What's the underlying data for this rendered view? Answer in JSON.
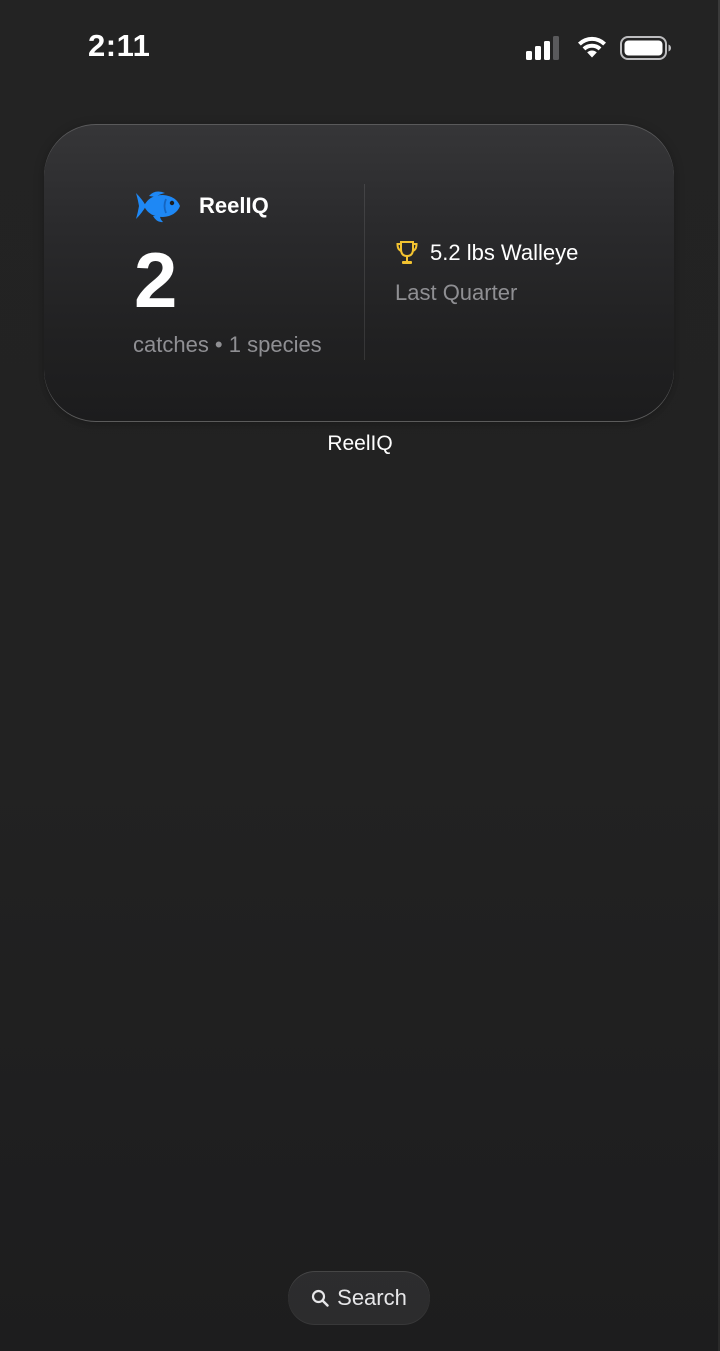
{
  "status_bar": {
    "time": "2:11",
    "icons": [
      "signal-icon",
      "wifi-icon",
      "battery-icon"
    ]
  },
  "widget": {
    "app_name": "ReelIQ",
    "app_icon": "fish-icon",
    "icon_color": "#1e88f5",
    "catch_count": "2",
    "subtitle": "catches • 1 species",
    "best_icon": "trophy-icon",
    "trophy_color": "#f2c230",
    "best_catch": "5.2 lbs Walleye",
    "period": "Last Quarter",
    "label": "ReelIQ"
  },
  "search": {
    "label": "Search",
    "icon": "search-icon"
  }
}
